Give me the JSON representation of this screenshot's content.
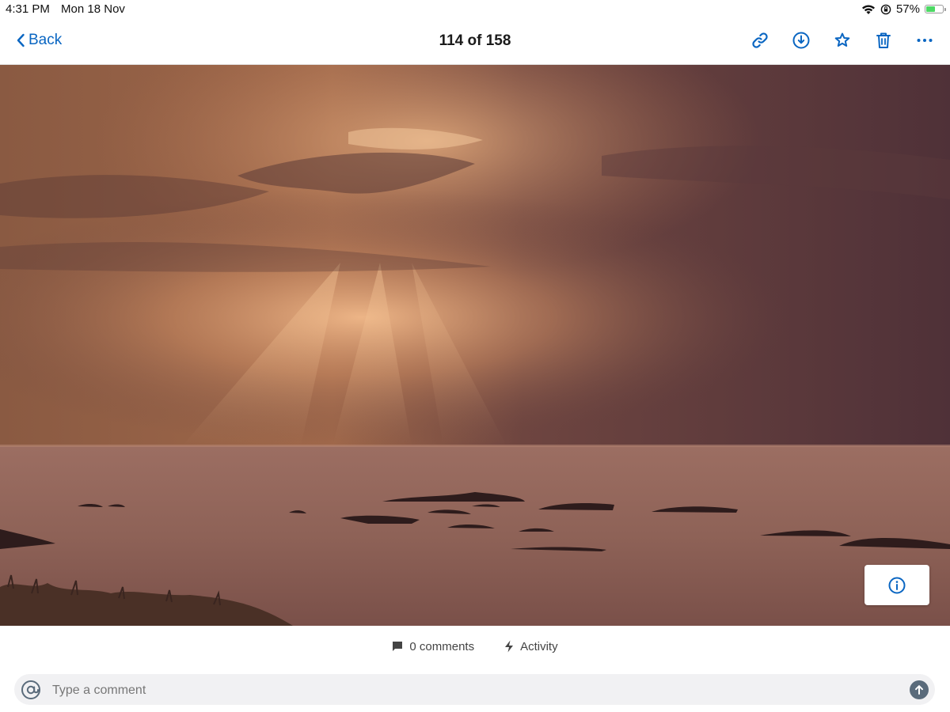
{
  "status_bar": {
    "time": "4:31 PM",
    "date": "Mon 18 Nov",
    "battery_text": "57%",
    "battery_level": 0.57,
    "icons": [
      "wifi-icon",
      "orientation-lock-icon",
      "battery-icon"
    ]
  },
  "nav": {
    "back_label": "Back",
    "title": "114 of 158",
    "actions": [
      "link-icon",
      "download-icon",
      "star-icon",
      "trash-icon",
      "more-icon"
    ]
  },
  "photo": {
    "subject": "sunset-over-sea"
  },
  "tabs": {
    "comments_label": "0 comments",
    "activity_label": "Activity"
  },
  "comment": {
    "placeholder": "Type a comment"
  },
  "colors": {
    "accent": "#0a66c2",
    "send_button": "#5a6b7b",
    "battery_fill": "#4cd964"
  }
}
